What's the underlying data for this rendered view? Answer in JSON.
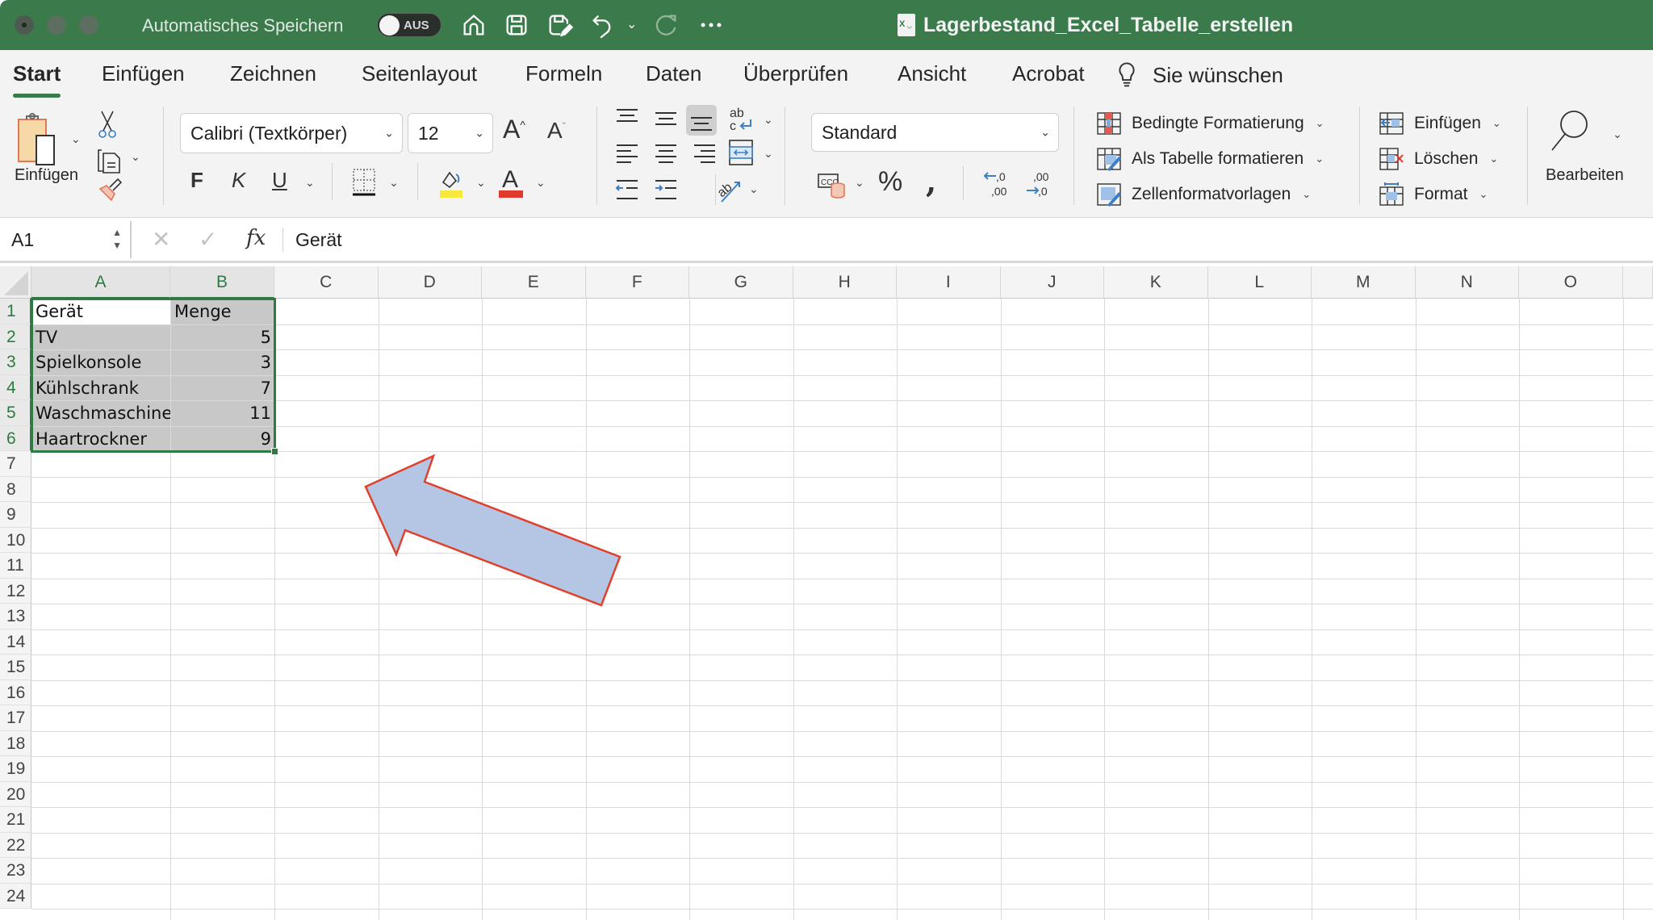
{
  "titlebar": {
    "autosave_label": "Automatisches Speichern",
    "autosave_state": "AUS",
    "document_title": "Lagerbestand_Excel_Tabelle_erstellen",
    "icons": [
      "home-icon",
      "save-icon",
      "save-as-icon",
      "undo-icon",
      "redo-icon",
      "more-icon"
    ]
  },
  "tabs": [
    {
      "label": "Start",
      "active": true
    },
    {
      "label": "Einfügen"
    },
    {
      "label": "Zeichnen"
    },
    {
      "label": "Seitenlayout"
    },
    {
      "label": "Formeln"
    },
    {
      "label": "Daten"
    },
    {
      "label": "Überprüfen"
    },
    {
      "label": "Ansicht"
    },
    {
      "label": "Acrobat"
    }
  ],
  "tell_me": "Sie wünschen",
  "ribbon": {
    "paste_label": "Einfügen",
    "font_name": "Calibri (Textkörper)",
    "font_size": "12",
    "bold": "F",
    "italic": "K",
    "underline": "U",
    "number_format": "Standard",
    "styles": {
      "conditional": "Bedingte Formatierung",
      "as_table": "Als Tabelle formatieren",
      "cell_styles": "Zellenformatvorlagen"
    },
    "cells": {
      "insert": "Einfügen",
      "delete": "Löschen",
      "format": "Format"
    },
    "edit_label": "Bearbeiten",
    "colors": {
      "highlight": "#f5e93d",
      "font_color": "#e03a2e",
      "accent": "#3a7a4b"
    }
  },
  "formula_bar": {
    "name_box": "A1",
    "content": "Gerät"
  },
  "sheet": {
    "columns": [
      "A",
      "B",
      "C",
      "D",
      "E",
      "F",
      "G",
      "H",
      "I",
      "J",
      "K",
      "L",
      "M",
      "N",
      "O"
    ],
    "rows": [
      "1",
      "2",
      "3",
      "4",
      "5",
      "6",
      "7",
      "8",
      "9",
      "10",
      "11",
      "12",
      "13",
      "14",
      "15",
      "16",
      "17",
      "18",
      "19",
      "20",
      "21",
      "22",
      "23",
      "24"
    ],
    "selected_range": "A1:B6",
    "data": [
      [
        "Gerät",
        "Menge"
      ],
      [
        "TV",
        "5"
      ],
      [
        "Spielkonsole",
        "3"
      ],
      [
        "Kühlschrank",
        "7"
      ],
      [
        "Waschmaschine",
        "11"
      ],
      [
        "Haartrockner",
        "9"
      ]
    ]
  },
  "annotation": {
    "shape": "arrow",
    "fill": "#b4c6e3",
    "stroke": "#e0402c"
  }
}
